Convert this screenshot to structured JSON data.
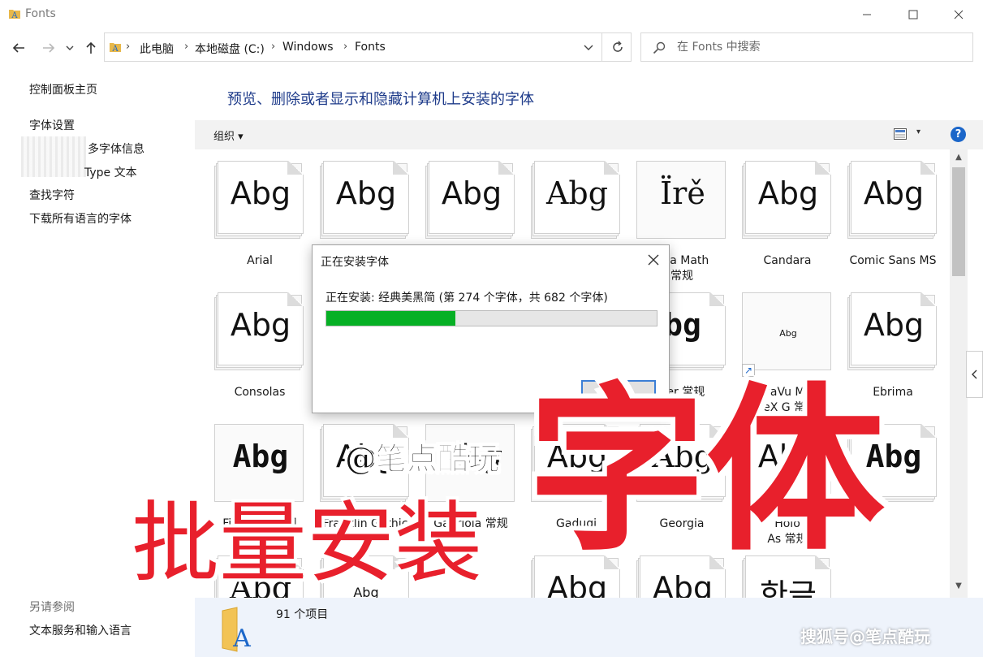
{
  "window": {
    "title": "Fonts"
  },
  "address": {
    "crumbs": [
      "此电脑",
      "本地磁盘 (C:)",
      "Windows",
      "Fonts"
    ]
  },
  "search": {
    "placeholder": "在 Fonts 中搜索"
  },
  "sidebar": {
    "home": "控制面板主页",
    "links": [
      "字体设置",
      "多字体信息",
      "Type 文本",
      "查找字符",
      "下载所有语言的字体"
    ],
    "see_also_label": "另请参阅",
    "see_also_links": [
      "文本服务和输入语言"
    ]
  },
  "main": {
    "heading": "预览、删除或者显示和隐藏计算机上安装的字体",
    "organize_label": "组织 ▾",
    "help_label": "?"
  },
  "fonts": [
    {
      "sample": "Abg",
      "name": "Arial"
    },
    {
      "sample": "Abg",
      "name": ""
    },
    {
      "sample": "Abg",
      "name": ""
    },
    {
      "sample": "Abg",
      "name": ""
    },
    {
      "sample": "Ïrě",
      "name": "bria Math",
      "name2": "常规"
    },
    {
      "sample": "Abg",
      "name": "Candara"
    },
    {
      "sample": "Abg",
      "name": "Comic Sans MS"
    },
    {
      "sample": "Abg",
      "name": "Consolas"
    },
    {
      "sample": "bg",
      "name": "rier 常规"
    },
    {
      "sample": "Abg",
      "name": "DejaVu Math",
      "name2": "TeX G  常规"
    },
    {
      "sample": "Abg",
      "name": "Ebrima"
    },
    {
      "sample": "Abg",
      "name": "Fixedsys 常规"
    },
    {
      "sample": "Abg",
      "name": "Franklin Gothic"
    },
    {
      "sample": "Abg",
      "name": "Gabriola 常规"
    },
    {
      "sample": "Abg",
      "name": "Gadugi"
    },
    {
      "sample": "Abg",
      "name": "Georgia"
    },
    {
      "sample": "Abg",
      "name": "Holo",
      "name2": "As  常规"
    },
    {
      "sample": "Abg",
      "name": ""
    },
    {
      "sample": "Abg",
      "name": ""
    },
    {
      "sample": "Abg",
      "name": ""
    },
    {
      "sample": "Abg",
      "name": ""
    },
    {
      "sample": "Abg",
      "name": ""
    },
    {
      "sample": "한글",
      "name": ""
    }
  ],
  "status": {
    "count": "91 个项目"
  },
  "dialog": {
    "title": "正在安装字体",
    "status": "正在安装: 经典美黑简 (第 274 个字体，共 682 个字体)",
    "progress": 0.39,
    "stop_label": "停止"
  },
  "overlay": {
    "handle": "@笔点酷玩",
    "main": "批量安装",
    "big": "字体",
    "watermark": "搜狐号@笔点酷玩"
  },
  "colors": {
    "accent": "#1b66c9",
    "progress": "#06b025",
    "overlay_red": "#e8202c",
    "heading_blue": "#1e3b8a"
  }
}
